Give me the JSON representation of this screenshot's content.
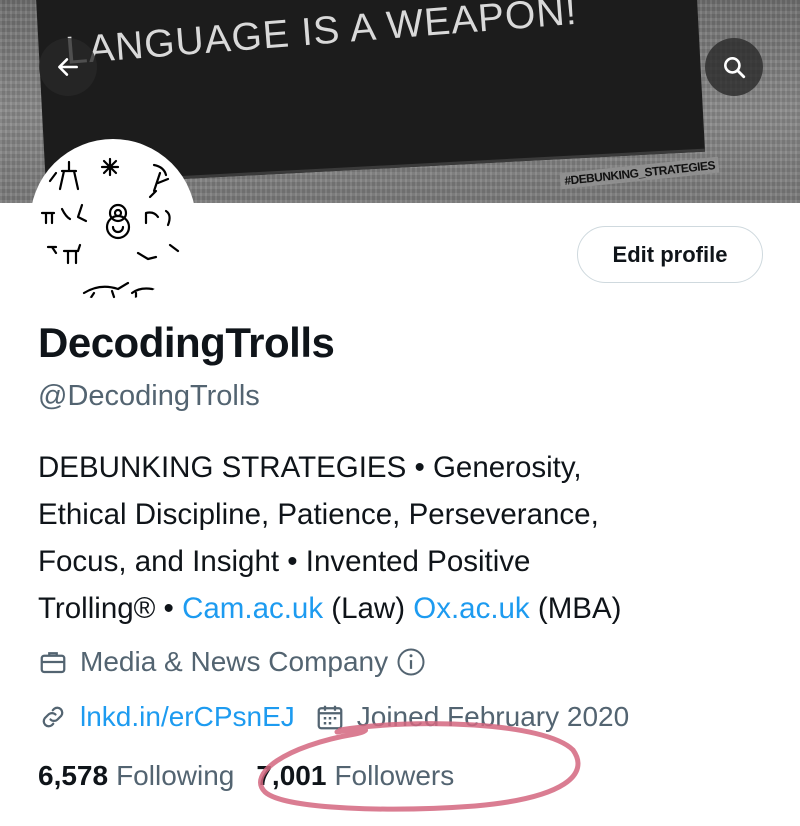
{
  "banner": {
    "slogan": "LANGUAGE IS A WEAPON!",
    "tag": "#DEBUNKING_STRATEGIES"
  },
  "nav": {
    "back_icon": "arrow-left-icon",
    "search_icon": "search-icon"
  },
  "profile": {
    "edit_label": "Edit profile",
    "display_name": "DecodingTrolls",
    "handle": "@DecodingTrolls",
    "bio": {
      "line1": "DEBUNKING STRATEGIES • Generosity,",
      "line2": "Ethical Discipline, Patience, Perseverance,",
      "line3": "Focus, and Insight • Invented Positive",
      "line4_pre": "Trolling® • ",
      "link1": "Cam.ac.uk",
      "mid1": " (Law) ",
      "link2": "Ox.ac.uk",
      "mid2": " (MBA)"
    },
    "category": "Media & News Company",
    "category_info_icon": "info-icon",
    "website": "lnkd.in/erCPsnEJ",
    "joined": "Joined February 2020"
  },
  "stats": {
    "following_count": "6,578",
    "following_label": "Following",
    "followers_count": "7,001",
    "followers_label": "Followers"
  },
  "colors": {
    "link": "#1d9bf0",
    "secondary_text": "#536471",
    "annotation": "#d4667f"
  }
}
